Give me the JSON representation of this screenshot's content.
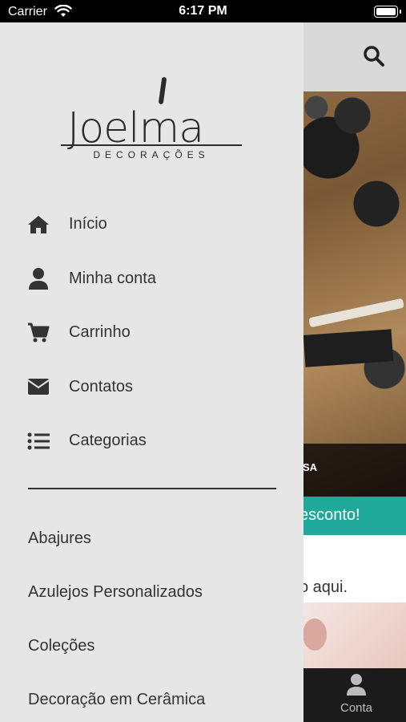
{
  "status_bar": {
    "carrier": "Carrier",
    "time": "6:17 PM"
  },
  "background_app": {
    "hero_banner_text": "SA",
    "promo_text": "esconto!",
    "body_text": "o aqui.",
    "tab_conta_label": "Conta"
  },
  "drawer": {
    "logo": {
      "word": "Joelma",
      "subtitle": "DECORAÇÕES"
    },
    "menu_items": [
      {
        "label": "Início",
        "icon": "home-icon"
      },
      {
        "label": "Minha conta",
        "icon": "user-icon"
      },
      {
        "label": "Carrinho",
        "icon": "cart-icon"
      },
      {
        "label": "Contatos",
        "icon": "envelope-icon"
      },
      {
        "label": "Categorias",
        "icon": "list-icon"
      }
    ],
    "categories": [
      "Abajures",
      "Azulejos Personalizados",
      "Coleções",
      "Decoração em Cerâmica"
    ]
  },
  "colors": {
    "drawer_bg": "#e6e6e6",
    "promo": "#1fa99a",
    "text": "#333333"
  }
}
